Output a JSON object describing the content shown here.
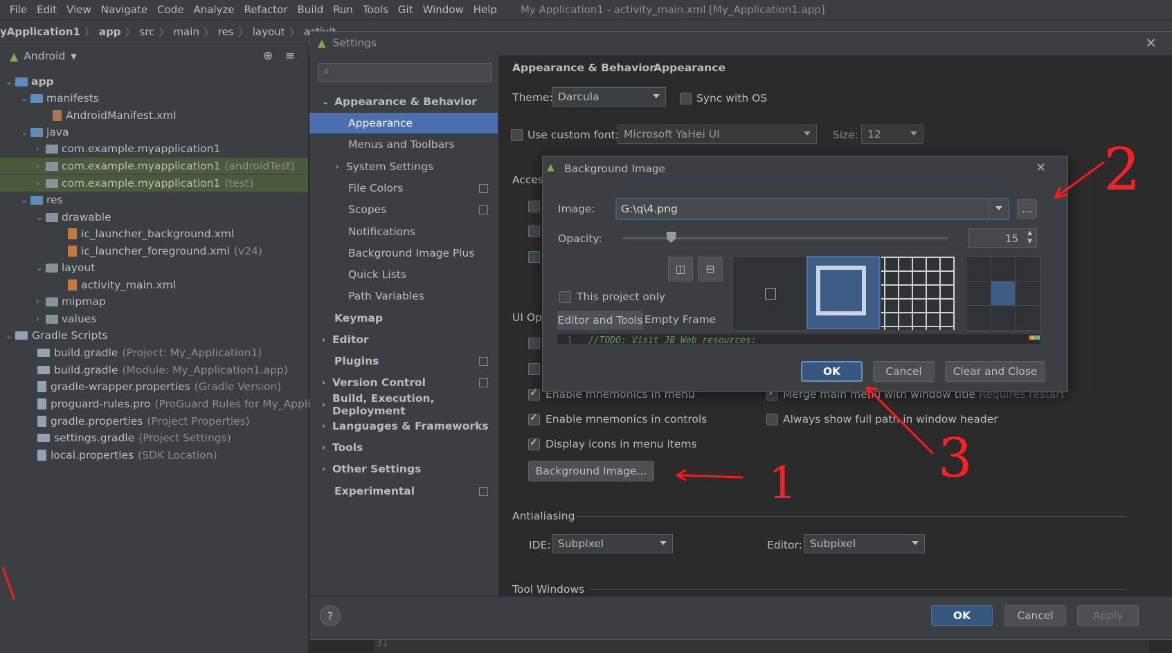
{
  "menubar": {
    "items": [
      "File",
      "Edit",
      "View",
      "Navigate",
      "Code",
      "Analyze",
      "Refactor",
      "Build",
      "Run",
      "Tools",
      "Git",
      "Window",
      "Help"
    ],
    "window_title": "My Application1 - activity_main.xml [My_Application1.app]"
  },
  "breadcrumb": [
    "yApplication1",
    "app",
    "src",
    "main",
    "res",
    "layout",
    "activit"
  ],
  "project": {
    "view_label": "Android",
    "tree": [
      {
        "label": "app",
        "hint": ""
      },
      {
        "label": "manifests",
        "hint": ""
      },
      {
        "label": "AndroidManifest.xml",
        "hint": ""
      },
      {
        "label": "java",
        "hint": ""
      },
      {
        "label": "com.example.myapplication1",
        "hint": ""
      },
      {
        "label": "com.example.myapplication1",
        "hint": "(androidTest)"
      },
      {
        "label": "com.example.myapplication1",
        "hint": "(test)"
      },
      {
        "label": "res",
        "hint": ""
      },
      {
        "label": "drawable",
        "hint": ""
      },
      {
        "label": "ic_launcher_background.xml",
        "hint": ""
      },
      {
        "label": "ic_launcher_foreground.xml",
        "hint": "(v24)"
      },
      {
        "label": "layout",
        "hint": ""
      },
      {
        "label": "activity_main.xml",
        "hint": ""
      },
      {
        "label": "mipmap",
        "hint": ""
      },
      {
        "label": "values",
        "hint": ""
      },
      {
        "label": "Gradle Scripts",
        "hint": ""
      },
      {
        "label": "build.gradle",
        "hint": "(Project: My_Application1)"
      },
      {
        "label": "build.gradle",
        "hint": "(Module: My_Application1.app)"
      },
      {
        "label": "gradle-wrapper.properties",
        "hint": "(Gradle Version)"
      },
      {
        "label": "proguard-rules.pro",
        "hint": "(ProGuard Rules for My_Applic"
      },
      {
        "label": "gradle.properties",
        "hint": "(Project Properties)"
      },
      {
        "label": "settings.gradle",
        "hint": "(Project Settings)"
      },
      {
        "label": "local.properties",
        "hint": "(SDK Location)"
      }
    ]
  },
  "settings": {
    "title": "Settings",
    "nav": [
      {
        "label": "Appearance & Behavior"
      },
      {
        "label": "Appearance"
      },
      {
        "label": "Menus and Toolbars"
      },
      {
        "label": "System Settings"
      },
      {
        "label": "File Colors"
      },
      {
        "label": "Scopes"
      },
      {
        "label": "Notifications"
      },
      {
        "label": "Background Image Plus"
      },
      {
        "label": "Quick Lists"
      },
      {
        "label": "Path Variables"
      },
      {
        "label": "Keymap"
      },
      {
        "label": "Editor"
      },
      {
        "label": "Plugins"
      },
      {
        "label": "Version Control"
      },
      {
        "label": "Build, Execution, Deployment"
      },
      {
        "label": "Languages & Frameworks"
      },
      {
        "label": "Tools"
      },
      {
        "label": "Other Settings"
      },
      {
        "label": "Experimental"
      }
    ],
    "breadcrumb_parent": "Appearance & Behavior",
    "breadcrumb_current": "Appearance",
    "theme_label": "Theme:",
    "theme_value": "Darcula",
    "sync_os_label": "Sync with OS",
    "custom_font_label": "Use custom font:",
    "font_value": "Microsoft YaHei UI",
    "size_label": "Size:",
    "size_value": "12",
    "access_label": "Acces",
    "ui_options_label": "UI Op",
    "enable_mnemonics_menu": "Enable mnemonics in menu",
    "merge_menu": "Merge main menu with window title",
    "requires_restart": "Requires restart",
    "enable_mnemonics_controls": "Enable mnemonics in controls",
    "show_full_path": "Always show full path in window header",
    "display_icons": "Display icons in menu items",
    "background_image_button": "Background Image...",
    "antialiasing_label": "Antialiasing",
    "ide_label": "IDE:",
    "ide_value": "Subpixel",
    "editor_label": "Editor:",
    "editor_value": "Subpixel",
    "tool_windows_label": "Tool Windows",
    "ok": "OK",
    "cancel": "Cancel",
    "apply": "Apply",
    "help": "?"
  },
  "bg_dialog": {
    "title": "Background Image",
    "image_label": "Image:",
    "image_value": "G:\\q\\4.png",
    "browse": "...",
    "opacity_label": "Opacity:",
    "opacity_value": "15",
    "opacity_fraction": 0.15,
    "project_only": "This project only",
    "tab_editor": "Editor and Tools",
    "tab_frame": "Empty Frame",
    "code_line_no": "1",
    "code_preview": "//TODO: Visit JB Web resources:",
    "ok": "OK",
    "cancel": "Cancel",
    "clear_close": "Clear and Close"
  },
  "editor_gutter": {
    "line": "31"
  },
  "annotations": [
    "1",
    "2",
    "3"
  ]
}
